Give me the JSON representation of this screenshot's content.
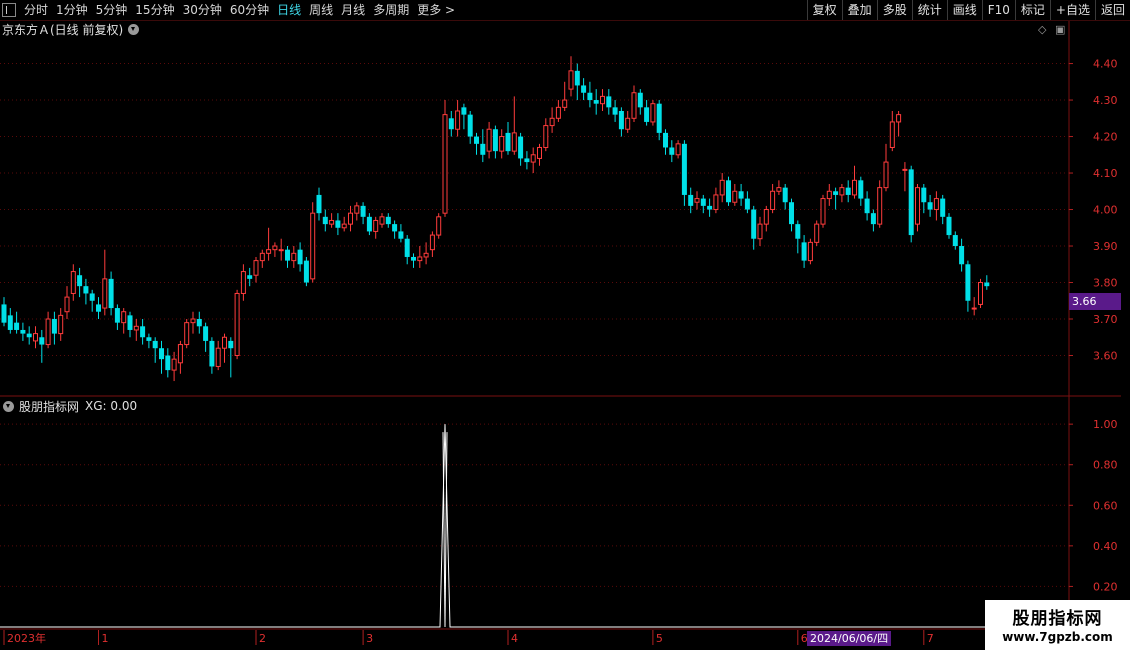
{
  "toolbar": {
    "periods": [
      "分时",
      "1分钟",
      "5分钟",
      "15分钟",
      "30分钟",
      "60分钟",
      "日线",
      "周线",
      "月线",
      "多周期",
      "更多 >"
    ],
    "active_period": "日线",
    "buttons": [
      "复权",
      "叠加",
      "多股",
      "统计",
      "画线",
      "F10",
      "标记",
      "+自选",
      "返回"
    ]
  },
  "main_chart": {
    "title": "京东方Ａ(日线 前复权)",
    "current_price": "3.66",
    "y_labels": [
      "4.40",
      "4.30",
      "4.20",
      "4.10",
      "4.00",
      "3.90",
      "3.80",
      "3.70",
      "3.60"
    ]
  },
  "sub_chart": {
    "title": "股朋指标网",
    "indicator": "XG: 0.00",
    "y_labels": [
      "1.00",
      "0.80",
      "0.60",
      "0.40",
      "0.20"
    ]
  },
  "date_axis": {
    "labels": [
      "2023年",
      "1",
      "2",
      "3",
      "4",
      "5",
      "6",
      "7"
    ],
    "cursor_date": "2024/06/06/四"
  },
  "watermark": {
    "line1": "股朋指标网",
    "line2": "www.7gpzb.com"
  },
  "colors": {
    "up": "#ff3c3c",
    "down": "#00e0e8",
    "background": "#000000",
    "grid": "#5a0a0a",
    "accent": "#5a1a8a"
  },
  "chart_data": [
    {
      "type": "candlestick",
      "title": "京东方Ａ(日线 前复权)",
      "ylim": [
        3.5,
        4.47
      ],
      "x_period_labels": [
        "2023年",
        "1",
        "2",
        "3",
        "4",
        "5",
        "6",
        "7"
      ],
      "ohlc": [
        [
          3.74,
          3.69,
          3.76,
          3.68
        ],
        [
          3.71,
          3.67,
          3.73,
          3.66
        ],
        [
          3.69,
          3.67,
          3.72,
          3.66
        ],
        [
          3.67,
          3.66,
          3.69,
          3.64
        ],
        [
          3.66,
          3.65,
          3.68,
          3.63
        ],
        [
          3.64,
          3.66,
          3.68,
          3.62
        ],
        [
          3.65,
          3.63,
          3.67,
          3.58
        ],
        [
          3.63,
          3.7,
          3.72,
          3.62
        ],
        [
          3.7,
          3.66,
          3.72,
          3.63
        ],
        [
          3.66,
          3.71,
          3.73,
          3.64
        ],
        [
          3.72,
          3.76,
          3.79,
          3.7
        ],
        [
          3.77,
          3.83,
          3.85,
          3.75
        ],
        [
          3.82,
          3.79,
          3.84,
          3.76
        ],
        [
          3.79,
          3.77,
          3.81,
          3.74
        ],
        [
          3.77,
          3.75,
          3.78,
          3.72
        ],
        [
          3.74,
          3.72,
          3.76,
          3.7
        ],
        [
          3.73,
          3.81,
          3.89,
          3.71
        ],
        [
          3.81,
          3.73,
          3.83,
          3.71
        ],
        [
          3.73,
          3.69,
          3.74,
          3.67
        ],
        [
          3.69,
          3.72,
          3.73,
          3.66
        ],
        [
          3.71,
          3.67,
          3.72,
          3.65
        ],
        [
          3.67,
          3.68,
          3.7,
          3.64
        ],
        [
          3.68,
          3.65,
          3.7,
          3.63
        ],
        [
          3.65,
          3.64,
          3.66,
          3.62
        ],
        [
          3.64,
          3.62,
          3.65,
          3.58
        ],
        [
          3.62,
          3.59,
          3.64,
          3.55
        ],
        [
          3.6,
          3.56,
          3.62,
          3.54
        ],
        [
          3.56,
          3.59,
          3.61,
          3.53
        ],
        [
          3.58,
          3.63,
          3.64,
          3.55
        ],
        [
          3.63,
          3.69,
          3.7,
          3.62
        ],
        [
          3.69,
          3.7,
          3.72,
          3.66
        ],
        [
          3.7,
          3.68,
          3.72,
          3.66
        ],
        [
          3.68,
          3.64,
          3.69,
          3.61
        ],
        [
          3.64,
          3.57,
          3.65,
          3.55
        ],
        [
          3.57,
          3.62,
          3.64,
          3.56
        ],
        [
          3.62,
          3.65,
          3.66,
          3.58
        ],
        [
          3.64,
          3.62,
          3.65,
          3.54
        ],
        [
          3.6,
          3.77,
          3.78,
          3.59
        ],
        [
          3.77,
          3.83,
          3.85,
          3.75
        ],
        [
          3.82,
          3.81,
          3.84,
          3.79
        ],
        [
          3.82,
          3.86,
          3.87,
          3.8
        ],
        [
          3.86,
          3.88,
          3.89,
          3.84
        ],
        [
          3.88,
          3.89,
          3.95,
          3.86
        ],
        [
          3.89,
          3.9,
          3.91,
          3.87
        ],
        [
          3.89,
          3.89,
          3.92,
          3.86
        ],
        [
          3.89,
          3.86,
          3.9,
          3.84
        ],
        [
          3.86,
          3.88,
          3.9,
          3.84
        ],
        [
          3.89,
          3.85,
          3.91,
          3.83
        ],
        [
          3.86,
          3.8,
          3.87,
          3.79
        ],
        [
          3.81,
          3.99,
          4.02,
          3.8
        ],
        [
          4.04,
          3.99,
          4.06,
          3.97
        ],
        [
          3.98,
          3.96,
          4.0,
          3.94
        ],
        [
          3.96,
          3.97,
          3.99,
          3.95
        ],
        [
          3.97,
          3.95,
          3.99,
          3.93
        ],
        [
          3.95,
          3.96,
          3.98,
          3.94
        ],
        [
          3.96,
          3.99,
          4.01,
          3.94
        ],
        [
          3.99,
          4.01,
          4.02,
          3.97
        ],
        [
          4.01,
          3.98,
          4.02,
          3.96
        ],
        [
          3.98,
          3.94,
          3.99,
          3.93
        ],
        [
          3.94,
          3.97,
          3.98,
          3.92
        ],
        [
          3.96,
          3.98,
          3.99,
          3.95
        ],
        [
          3.98,
          3.96,
          3.99,
          3.95
        ],
        [
          3.96,
          3.94,
          3.97,
          3.92
        ],
        [
          3.94,
          3.92,
          3.96,
          3.91
        ],
        [
          3.92,
          3.87,
          3.93,
          3.85
        ],
        [
          3.87,
          3.86,
          3.88,
          3.84
        ],
        [
          3.86,
          3.87,
          3.9,
          3.84
        ],
        [
          3.87,
          3.88,
          3.91,
          3.85
        ],
        [
          3.89,
          3.93,
          3.94,
          3.87
        ],
        [
          3.93,
          3.98,
          3.99,
          3.92
        ],
        [
          3.99,
          4.26,
          4.3,
          3.98
        ],
        [
          4.25,
          4.22,
          4.27,
          4.2
        ],
        [
          4.22,
          4.27,
          4.3,
          4.2
        ],
        [
          4.28,
          4.26,
          4.29,
          4.22
        ],
        [
          4.26,
          4.2,
          4.27,
          4.18
        ],
        [
          4.2,
          4.18,
          4.21,
          4.15
        ],
        [
          4.18,
          4.15,
          4.22,
          4.13
        ],
        [
          4.16,
          4.22,
          4.24,
          4.14
        ],
        [
          4.22,
          4.16,
          4.23,
          4.14
        ],
        [
          4.16,
          4.2,
          4.22,
          4.14
        ],
        [
          4.21,
          4.16,
          4.24,
          4.15
        ],
        [
          4.16,
          4.21,
          4.31,
          4.15
        ],
        [
          4.2,
          4.14,
          4.21,
          4.12
        ],
        [
          4.14,
          4.13,
          4.16,
          4.11
        ],
        [
          4.13,
          4.15,
          4.17,
          4.1
        ],
        [
          4.14,
          4.17,
          4.18,
          4.12
        ],
        [
          4.17,
          4.23,
          4.25,
          4.16
        ],
        [
          4.23,
          4.25,
          4.28,
          4.21
        ],
        [
          4.25,
          4.28,
          4.3,
          4.24
        ],
        [
          4.28,
          4.3,
          4.35,
          4.27
        ],
        [
          4.33,
          4.38,
          4.42,
          4.31
        ],
        [
          4.38,
          4.34,
          4.4,
          4.3
        ],
        [
          4.34,
          4.32,
          4.36,
          4.3
        ],
        [
          4.32,
          4.3,
          4.35,
          4.28
        ],
        [
          4.3,
          4.29,
          4.33,
          4.26
        ],
        [
          4.29,
          4.31,
          4.33,
          4.27
        ],
        [
          4.31,
          4.28,
          4.33,
          4.26
        ],
        [
          4.28,
          4.26,
          4.3,
          4.24
        ],
        [
          4.27,
          4.22,
          4.28,
          4.2
        ],
        [
          4.22,
          4.25,
          4.27,
          4.21
        ],
        [
          4.25,
          4.32,
          4.34,
          4.24
        ],
        [
          4.32,
          4.28,
          4.33,
          4.26
        ],
        [
          4.28,
          4.24,
          4.3,
          4.23
        ],
        [
          4.24,
          4.29,
          4.3,
          4.23
        ],
        [
          4.29,
          4.21,
          4.3,
          4.19
        ],
        [
          4.21,
          4.17,
          4.22,
          4.15
        ],
        [
          4.17,
          4.15,
          4.19,
          4.13
        ],
        [
          4.15,
          4.18,
          4.19,
          4.14
        ],
        [
          4.18,
          4.04,
          4.19,
          4.01
        ],
        [
          4.04,
          4.01,
          4.06,
          3.99
        ],
        [
          4.02,
          4.03,
          4.05,
          4.0
        ],
        [
          4.03,
          4.01,
          4.04,
          3.99
        ],
        [
          4.01,
          4.0,
          4.03,
          3.98
        ],
        [
          4.0,
          4.04,
          4.06,
          3.99
        ],
        [
          4.04,
          4.08,
          4.1,
          4.02
        ],
        [
          4.08,
          4.02,
          4.09,
          4.01
        ],
        [
          4.02,
          4.05,
          4.07,
          4.01
        ],
        [
          4.05,
          4.03,
          4.07,
          4.01
        ],
        [
          4.03,
          4.0,
          4.05,
          3.99
        ],
        [
          4.0,
          3.92,
          4.01,
          3.89
        ],
        [
          3.92,
          3.96,
          3.98,
          3.9
        ],
        [
          3.96,
          4.0,
          4.01,
          3.94
        ],
        [
          4.0,
          4.05,
          4.07,
          3.99
        ],
        [
          4.05,
          4.06,
          4.08,
          4.04
        ],
        [
          4.06,
          4.02,
          4.07,
          4.0
        ],
        [
          4.02,
          3.96,
          4.03,
          3.94
        ],
        [
          3.96,
          3.92,
          3.97,
          3.88
        ],
        [
          3.91,
          3.86,
          3.93,
          3.84
        ],
        [
          3.86,
          3.91,
          3.92,
          3.85
        ],
        [
          3.91,
          3.96,
          3.97,
          3.9
        ],
        [
          3.96,
          4.03,
          4.04,
          3.95
        ],
        [
          4.03,
          4.05,
          4.07,
          4.01
        ],
        [
          4.05,
          4.04,
          4.06,
          4.0
        ],
        [
          4.04,
          4.06,
          4.07,
          4.02
        ],
        [
          4.06,
          4.04,
          4.08,
          4.02
        ],
        [
          4.04,
          4.08,
          4.12,
          4.03
        ],
        [
          4.08,
          4.03,
          4.09,
          4.01
        ],
        [
          4.03,
          3.99,
          4.05,
          3.97
        ],
        [
          3.99,
          3.96,
          4.0,
          3.94
        ],
        [
          3.96,
          4.06,
          4.08,
          3.95
        ],
        [
          4.06,
          4.13,
          4.18,
          4.05
        ],
        [
          4.17,
          4.24,
          4.27,
          4.16
        ],
        [
          4.24,
          4.26,
          4.27,
          4.2
        ],
        [
          4.11,
          4.11,
          4.13,
          4.05
        ],
        [
          4.11,
          3.93,
          4.12,
          3.91
        ],
        [
          3.96,
          4.06,
          4.07,
          3.94
        ],
        [
          4.06,
          4.02,
          4.07,
          3.99
        ],
        [
          4.02,
          4.0,
          4.04,
          3.98
        ],
        [
          4.0,
          4.03,
          4.05,
          3.97
        ],
        [
          4.03,
          3.98,
          4.04,
          3.96
        ],
        [
          3.98,
          3.93,
          3.99,
          3.92
        ],
        [
          3.93,
          3.9,
          3.94,
          3.89
        ],
        [
          3.9,
          3.85,
          3.92,
          3.83
        ],
        [
          3.85,
          3.75,
          3.86,
          3.72
        ],
        [
          3.73,
          3.73,
          3.76,
          3.71
        ],
        [
          3.74,
          3.8,
          3.81,
          3.73
        ],
        [
          3.8,
          3.79,
          3.82,
          3.78
        ]
      ]
    },
    {
      "type": "line",
      "title": "股朋指标网",
      "series": [
        {
          "name": "XG",
          "spike_index": 70,
          "spike_value": 1.0,
          "baseline": 0.0
        }
      ],
      "ylim": [
        0,
        1.05
      ]
    }
  ]
}
